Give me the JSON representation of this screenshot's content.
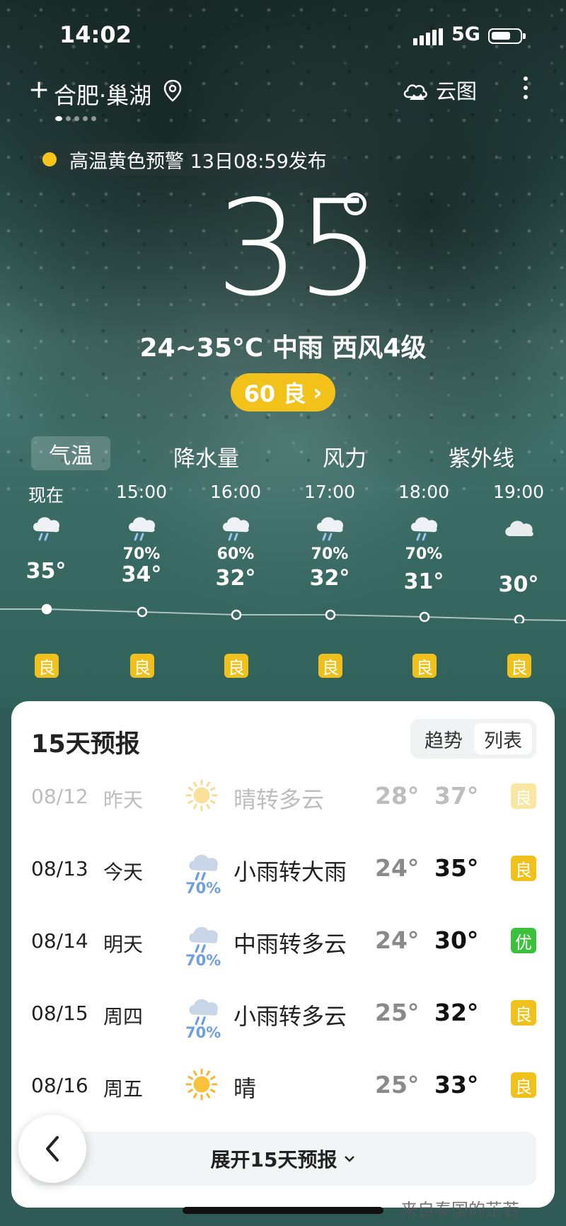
{
  "status": {
    "time": "14:02",
    "network": "5G"
  },
  "header": {
    "city": "合肥·巢湖",
    "cloud_map": "云图"
  },
  "alert": {
    "text": "高温黄色预警 13日08:59发布"
  },
  "current": {
    "temp": "35",
    "summary": "24~35°C 中雨 西风4级",
    "aqi": "60 良"
  },
  "tabs": [
    "气温",
    "降水量",
    "风力",
    "紫外线"
  ],
  "hourly": [
    {
      "time": "现在",
      "precip": "",
      "temp": "35°",
      "aqi": "良",
      "icon": "rain-cloud-icon"
    },
    {
      "time": "15:00",
      "precip": "70%",
      "temp": "34°",
      "aqi": "良",
      "icon": "rain-cloud-icon"
    },
    {
      "time": "16:00",
      "precip": "60%",
      "temp": "32°",
      "aqi": "良",
      "icon": "rain-cloud-icon"
    },
    {
      "time": "17:00",
      "precip": "70%",
      "temp": "32°",
      "aqi": "良",
      "icon": "rain-cloud-icon"
    },
    {
      "time": "18:00",
      "precip": "70%",
      "temp": "31°",
      "aqi": "良",
      "icon": "rain-cloud-icon"
    },
    {
      "time": "19:00",
      "precip": "",
      "temp": "30°",
      "aqi": "良",
      "icon": "cloud-icon"
    }
  ],
  "forecast": {
    "title": "15天预报",
    "toggle": {
      "trend": "趋势",
      "list": "列表"
    },
    "days": [
      {
        "date": "08/12",
        "weekday": "昨天",
        "precip": "",
        "condition": "晴转多云",
        "low": "28°",
        "high": "37°",
        "aqi": "良",
        "icon": "sun-icon"
      },
      {
        "date": "08/13",
        "weekday": "今天",
        "precip": "70%",
        "condition": "小雨转大雨",
        "low": "24°",
        "high": "35°",
        "aqi": "良",
        "icon": "rain-cloud-icon"
      },
      {
        "date": "08/14",
        "weekday": "明天",
        "precip": "70%",
        "condition": "中雨转多云",
        "low": "24°",
        "high": "30°",
        "aqi": "优",
        "icon": "rain-cloud-icon"
      },
      {
        "date": "08/15",
        "weekday": "周四",
        "precip": "70%",
        "condition": "小雨转多云",
        "low": "25°",
        "high": "32°",
        "aqi": "良",
        "icon": "rain-cloud-icon"
      },
      {
        "date": "08/16",
        "weekday": "周五",
        "precip": "",
        "condition": "晴",
        "low": "25°",
        "high": "33°",
        "aqi": "良",
        "icon": "sun-icon"
      }
    ],
    "expand": "展开15天预报"
  },
  "watermark": "来自泰国的芷若",
  "colors": {
    "aqi_good": "#f0c11a",
    "aqi_excellent": "#3cc13c",
    "alert_yellow": "#f5c518",
    "precip_blue": "#6e9ee0"
  }
}
